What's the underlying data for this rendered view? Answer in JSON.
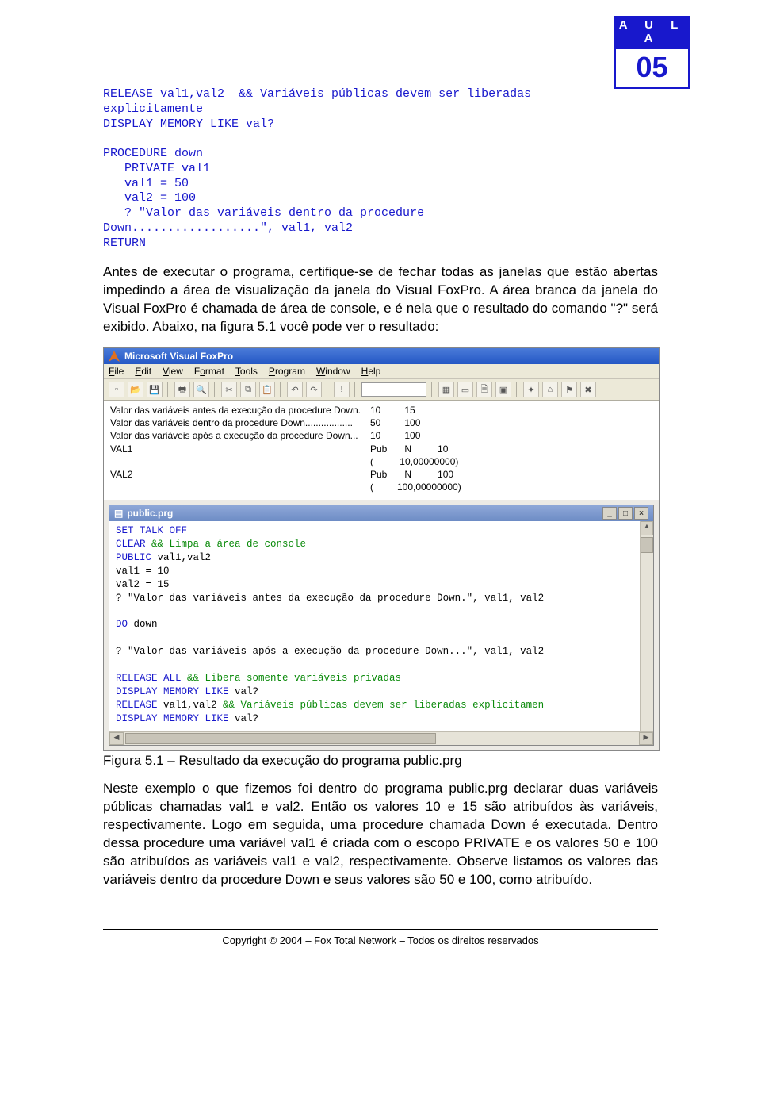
{
  "badge": {
    "label": "A U L A",
    "number": "05"
  },
  "code": {
    "line1": "RELEASE val1,val2  && Variáveis públicas devem ser liberadas",
    "line2": "explicitamente",
    "line3": "DISPLAY MEMORY LIKE val?",
    "line4": "",
    "line5": "PROCEDURE down",
    "line6": "   PRIVATE val1",
    "line7": "   val1 = 50",
    "line8": "   val2 = 100",
    "line9": "   ? \"Valor das variáveis dentro da procedure",
    "line10": "Down..................\", val1, val2",
    "line11": "RETURN"
  },
  "para1": "Antes de executar o programa, certifique-se de fechar todas as janelas que estão abertas impedindo a área de visualização da janela do Visual FoxPro. A área branca da janela do Visual FoxPro é chamada de área de console, e é nela que o resultado do comando \"?\" será exibido. Abaixo, na figura 5.1 você pode ver o resultado:",
  "screenshot": {
    "title": "Microsoft Visual FoxPro",
    "menu": [
      "File",
      "Edit",
      "View",
      "Format",
      "Tools",
      "Program",
      "Window",
      "Help"
    ],
    "console": {
      "rows": [
        [
          "Valor das variáveis antes da execução da procedure Down.",
          "10",
          "15"
        ],
        [
          "Valor das variáveis dentro da procedure Down..................",
          "50",
          "100"
        ],
        [
          "Valor das variáveis após a execução da procedure Down...",
          "10",
          "100"
        ]
      ],
      "vars": [
        {
          "name": "VAL1",
          "scope": "Pub",
          "type": "N",
          "val": "10",
          "raw": "(          10,00000000)"
        },
        {
          "name": "VAL2",
          "scope": "Pub",
          "type": "N",
          "val": "100",
          "raw": "(         100,00000000)"
        }
      ]
    },
    "child": {
      "title": "public.prg",
      "lines": [
        {
          "kw": "SET TALK OFF"
        },
        {
          "kw": "CLEAR",
          "cm": " && Limpa a área de console"
        },
        {
          "kw": "PUBLIC",
          "rest": " val1,val2"
        },
        {
          "rest": "val1 = 10"
        },
        {
          "rest": "val2 = 15"
        },
        {
          "rest": "? \"Valor das variáveis antes da execução da procedure Down.\", val1, val2"
        },
        {
          "blank": true
        },
        {
          "kw": "DO",
          "rest": " down"
        },
        {
          "blank": true
        },
        {
          "rest": "? \"Valor das variáveis após a execução da procedure Down...\", val1, val2 "
        },
        {
          "blank": true
        },
        {
          "kw": "RELEASE ALL",
          "cm": "       && Libera somente variáveis privadas"
        },
        {
          "kw": "DISPLAY MEMORY LIKE",
          "rest": " val?"
        },
        {
          "kw": "RELEASE",
          "rest": " val1,val2  ",
          "cm": "&& Variáveis públicas devem ser liberadas explicitamen"
        },
        {
          "kw": "DISPLAY MEMORY LIKE",
          "rest": " val?"
        }
      ]
    }
  },
  "caption": "Figura 5.1 – Resultado da execução do programa public.prg",
  "para2": "Neste exemplo o que fizemos foi dentro do programa public.prg declarar duas variáveis públicas chamadas val1 e val2. Então os valores 10 e 15 são atribuídos às variáveis, respectivamente. Logo em seguida, uma procedure chamada Down é executada. Dentro dessa procedure uma variável val1 é criada com o escopo PRIVATE e os valores 50 e 100 são atribuídos as variáveis val1 e val2, respectivamente. Observe listamos os valores das variáveis dentro da procedure Down e seus valores são 50 e 100, como atribuído.",
  "footer": "Copyright © 2004 – Fox Total Network – Todos os direitos reservados"
}
